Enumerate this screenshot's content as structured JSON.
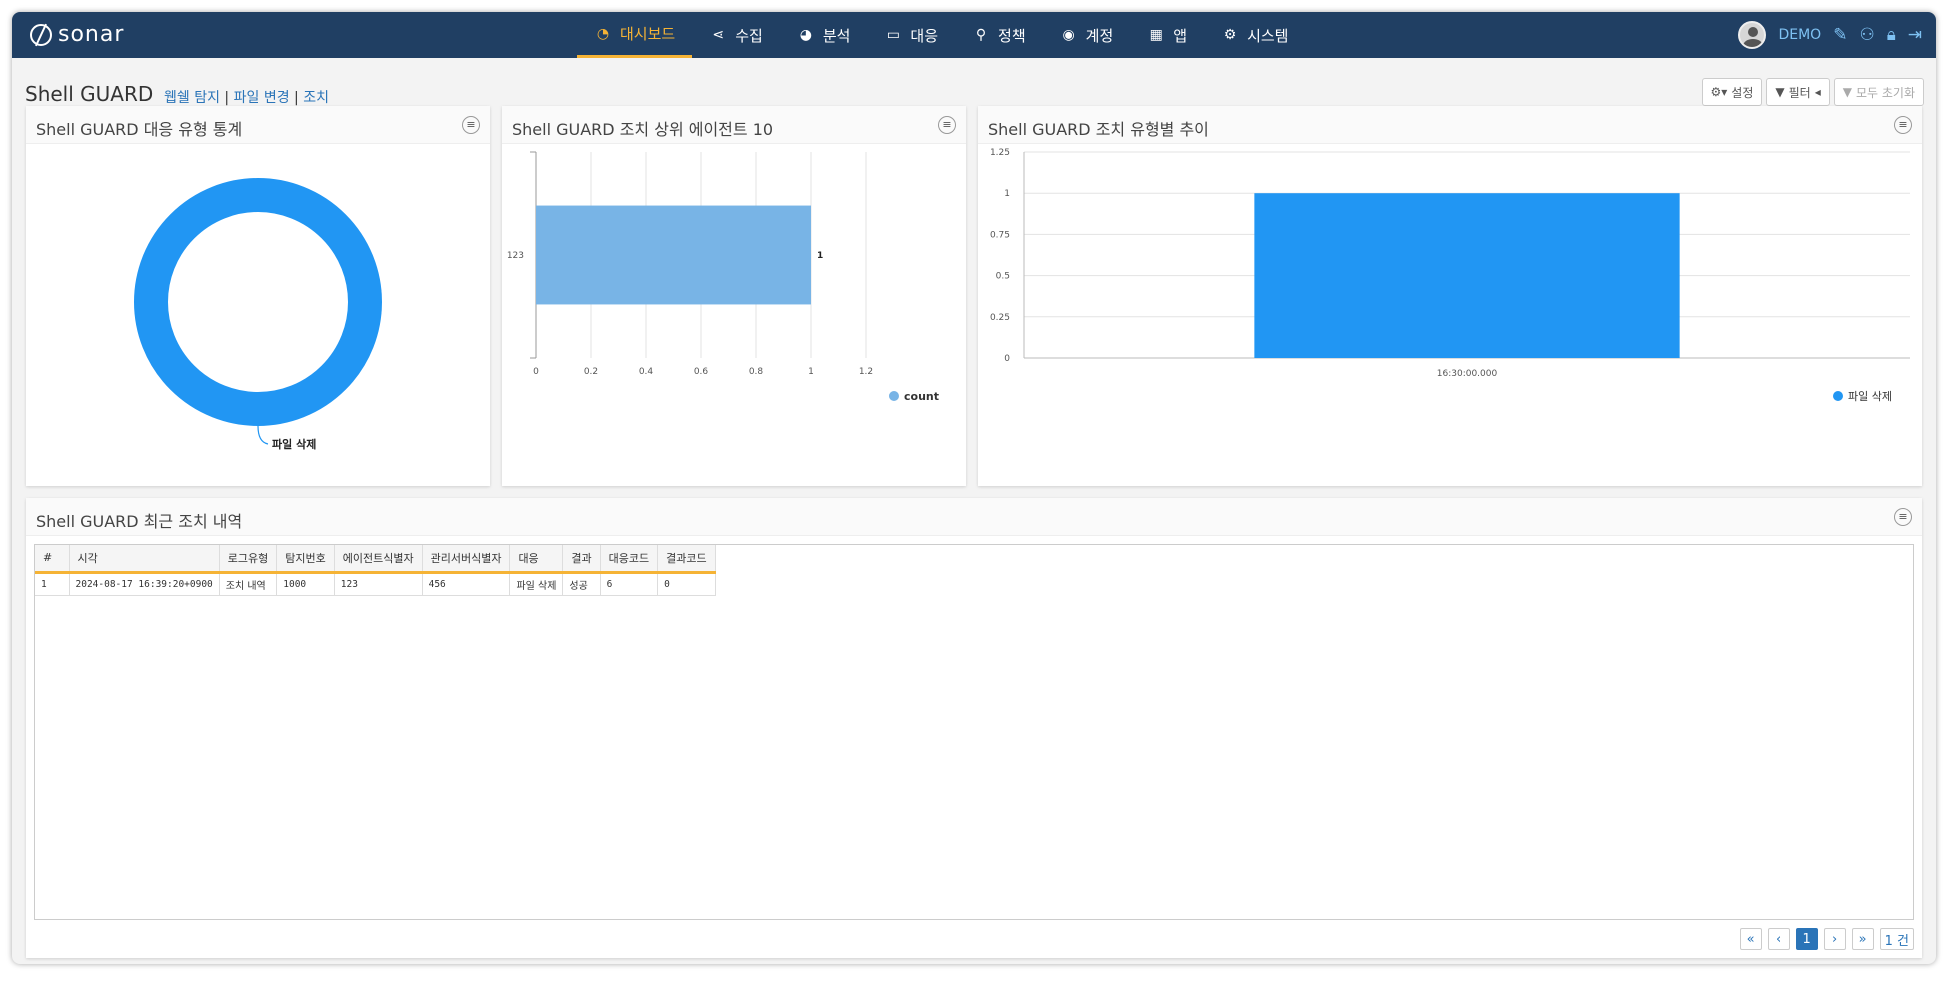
{
  "app": {
    "logo_text": "sonar",
    "user_name": "DEMO"
  },
  "menu": [
    {
      "label": "대시보드",
      "icon": "dashboard-icon",
      "glyph": "◔",
      "active": true
    },
    {
      "label": "수집",
      "icon": "share-icon",
      "glyph": "⋖",
      "active": false
    },
    {
      "label": "분석",
      "icon": "pie-icon",
      "glyph": "◕",
      "active": false
    },
    {
      "label": "대응",
      "icon": "laptop-icon",
      "glyph": "▭",
      "active": false
    },
    {
      "label": "정책",
      "icon": "search-icon",
      "glyph": "⚲",
      "active": false
    },
    {
      "label": "계정",
      "icon": "user-circle-icon",
      "glyph": "◉",
      "active": false
    },
    {
      "label": "앱",
      "icon": "grid-icon",
      "glyph": "▦",
      "active": false
    },
    {
      "label": "시스템",
      "icon": "gear-icon",
      "glyph": "⚙",
      "active": false
    }
  ],
  "page": {
    "title": "Shell GUARD",
    "links": [
      "웹쉘 탐지",
      "파일 변경",
      "조치"
    ],
    "settings_label": "설정",
    "filter_label": "필터",
    "reset_label": "모두 초기화"
  },
  "panels": {
    "donut_title": "Shell GUARD 대응 유형 통계",
    "top_agents_title": "Shell GUARD 조치 상위 에이전트 10",
    "trend_title": "Shell GUARD 조치 유형별 추이",
    "recent_title": "Shell GUARD 최근 조치 내역"
  },
  "chart_data": [
    {
      "type": "pie",
      "title": "Shell GUARD 대응 유형 통계",
      "categories": [
        "파일 삭제"
      ],
      "values": [
        1
      ],
      "donut": true,
      "color": "#2196f3"
    },
    {
      "type": "bar",
      "orientation": "horizontal",
      "title": "Shell GUARD 조치 상위 에이전트 10",
      "categories": [
        "123"
      ],
      "series": [
        {
          "name": "count",
          "values": [
            1
          ]
        }
      ],
      "xlim": [
        0,
        1.2
      ],
      "xticks": [
        "0",
        "0.2",
        "0.4",
        "0.6",
        "0.8",
        "1",
        "1.2"
      ],
      "data_labels": [
        "1"
      ],
      "color": "#78b4e6",
      "legend": "bottom-right"
    },
    {
      "type": "bar",
      "title": "Shell GUARD 조치 유형별 추이",
      "categories": [
        "16:30:00.000"
      ],
      "series": [
        {
          "name": "파일 삭제",
          "values": [
            1
          ]
        }
      ],
      "ylim": [
        0,
        1.25
      ],
      "yticks": [
        "0",
        "0.25",
        "0.5",
        "0.75",
        "1",
        "1.25"
      ],
      "color": "#2196f3",
      "legend": "bottom-right"
    }
  ],
  "table": {
    "columns": [
      "#",
      "시각",
      "로그유형",
      "탐지번호",
      "에이전트식별자",
      "관리서버식별자",
      "대응",
      "결과",
      "대응코드",
      "결과코드"
    ],
    "rows": [
      [
        "1",
        "2024-08-17 16:39:20+0900",
        "조치 내역",
        "1000",
        "123",
        "456",
        "파일 삭제",
        "성공",
        "6",
        "0"
      ]
    ]
  },
  "pagination": {
    "first": "«",
    "prev": "‹",
    "current": "1",
    "next": "›",
    "last": "»",
    "total": "1 건"
  }
}
